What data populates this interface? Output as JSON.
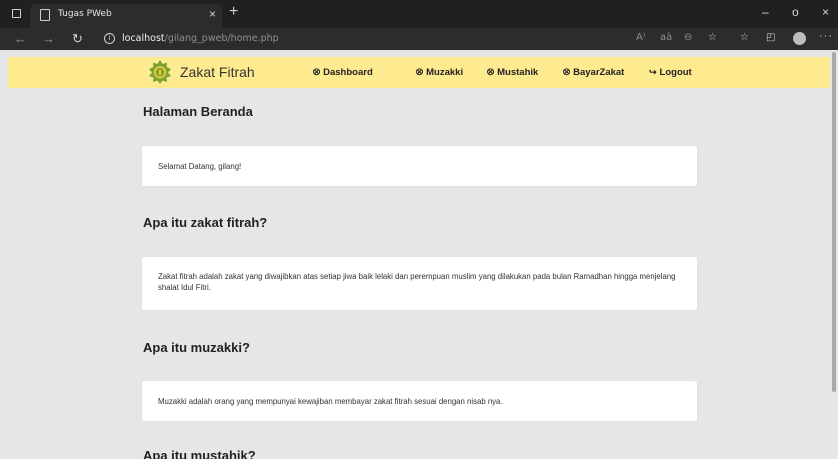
{
  "browser": {
    "tab_title": "Tugas PWeb",
    "tab_close": "×",
    "new_tab": "+",
    "url_host": "localhost",
    "url_path": "/gilang_pweb/home.php",
    "window_controls": {
      "minimize": "–",
      "maximize": "o",
      "close": "×"
    },
    "toolbar_icons": [
      "read-aloud-icon",
      "immersive-reader-icon",
      "zoom-icon",
      "favorites-add-icon",
      "favorites-icon",
      "collections-icon",
      "profile-icon",
      "more-icon"
    ],
    "toolbar_text": {
      "read_aloud": "A⁾",
      "immersive": "aà",
      "zoom": "⊖",
      "fav_add": "☆",
      "favorites": "☆",
      "collections": "◰",
      "more": "···"
    }
  },
  "site": {
    "brand": "Zakat Fitrah",
    "colors": {
      "nav_bg": "#ffeb8f",
      "page_bg": "#e5e6e7",
      "logo": "#7aa132"
    },
    "menu": [
      {
        "icon": "user-circle-icon",
        "glyph": "⭙",
        "label": "Dashboard"
      },
      {
        "icon": "user-circle-icon",
        "glyph": "⭙",
        "label": "Muzakki"
      },
      {
        "icon": "user-circle-icon",
        "glyph": "⭙",
        "label": "Mustahik"
      },
      {
        "icon": "user-circle-icon",
        "glyph": "⭙",
        "label": "BayarZakat"
      },
      {
        "icon": "logout-icon",
        "glyph": "↪",
        "label": "Logout"
      }
    ]
  },
  "content": {
    "title": "Halaman Beranda",
    "welcome": "Selamat Datang, gilang!",
    "sections": [
      {
        "heading": "Apa itu zakat fitrah?",
        "text": "Zakat fitrah adalah zakat yang diwajibkan atas setiap jiwa baik lelaki dan perempuan muslim yang dilakukan pada bulan Ramadhan hingga menjelang shalat Idul Fitri."
      },
      {
        "heading": "Apa itu muzakki?",
        "text": "Muzakki adalah orang yang mempunyai kewajiban membayar zakat fitrah sesuai dengan nisab nya."
      },
      {
        "heading": "Apa itu mustahik?",
        "text": ""
      }
    ]
  }
}
